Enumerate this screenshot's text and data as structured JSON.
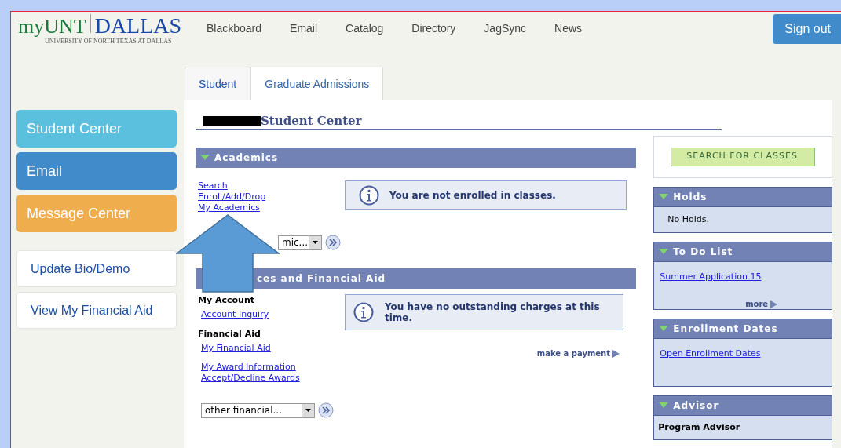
{
  "logo": {
    "my": "my",
    "unt": "UNT",
    "dallas": "DALLAS",
    "tagline": "UNIVERSITY OF NORTH TEXAS AT DALLAS"
  },
  "top_nav": [
    "Blackboard",
    "Email",
    "Catalog",
    "Directory",
    "JagSync",
    "News"
  ],
  "sign_out": "Sign out",
  "tabs": [
    {
      "label": "Student",
      "selected": false
    },
    {
      "label": "Graduate Admissions",
      "selected": true
    }
  ],
  "sidebar": {
    "tiles": [
      {
        "label": "Student Center",
        "color": "#5bc0de"
      },
      {
        "label": "Email",
        "color": "#428bca"
      },
      {
        "label": "Message Center",
        "color": "#f0ad4e"
      }
    ],
    "links": [
      "Update Bio/Demo",
      "View My Financial Aid"
    ]
  },
  "page_title": "Student Center",
  "academics": {
    "title": "Academics",
    "links": [
      "Search",
      "Enroll/Add/Drop",
      "My Academics"
    ],
    "notice": "You are not enrolled in classes.",
    "dropdown": "mic..."
  },
  "finances": {
    "title": "ces and Financial Aid",
    "groups": [
      {
        "heading": "My Account",
        "links": [
          "Account Inquiry"
        ]
      },
      {
        "heading": "Financial Aid",
        "links": [
          "My Financial Aid"
        ]
      },
      {
        "links": [
          "My Award Information",
          "Accept/Decline Awards"
        ]
      }
    ],
    "notice": "You have no outstanding charges at this time.",
    "payment_link": "make a payment",
    "dropdown": "other financial..."
  },
  "search_button": "SEARCH FOR CLASSES",
  "side_panels": [
    {
      "title": "Holds",
      "kind": "text",
      "text": "No Holds."
    },
    {
      "title": "To Do List",
      "kind": "links",
      "links": [
        "Summer Application 15"
      ],
      "more": "more"
    },
    {
      "title": "Enrollment Dates",
      "kind": "links",
      "links": [
        "Open Enrollment Dates"
      ]
    },
    {
      "title": "Advisor",
      "kind": "heading",
      "text": "Program Advisor"
    }
  ]
}
